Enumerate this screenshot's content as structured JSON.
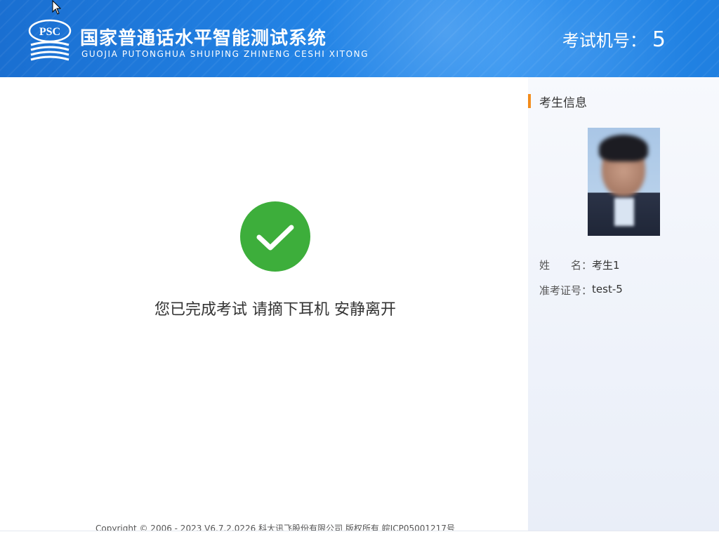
{
  "header": {
    "logo_text": "PSC",
    "title_cn": "国家普通话水平智能测试系统",
    "title_en": "GUOJIA PUTONGHUA SHUIPING ZHINENG CESHI XITONG",
    "exam_no_label": "考试机号：",
    "exam_no_value": "5"
  },
  "main": {
    "message": "您已完成考试 请摘下耳机 安静离开",
    "footer": "Copyright © 2006 - 2023 V6.7.2.0226 科大讯飞股份有限公司 版权所有 皖ICP05001217号"
  },
  "sidebar": {
    "title": "考生信息",
    "name_label": "姓　　名：",
    "name_value": "考生1",
    "id_label": "准考证号：",
    "id_value": "test-5"
  },
  "colors": {
    "header_blue": "#2384e6",
    "success_green": "#3dae3b",
    "accent_orange": "#f28c1c"
  },
  "icons": {
    "logo": "psc-logo-icon",
    "success": "checkmark-icon",
    "cursor": "mouse-cursor-icon"
  }
}
